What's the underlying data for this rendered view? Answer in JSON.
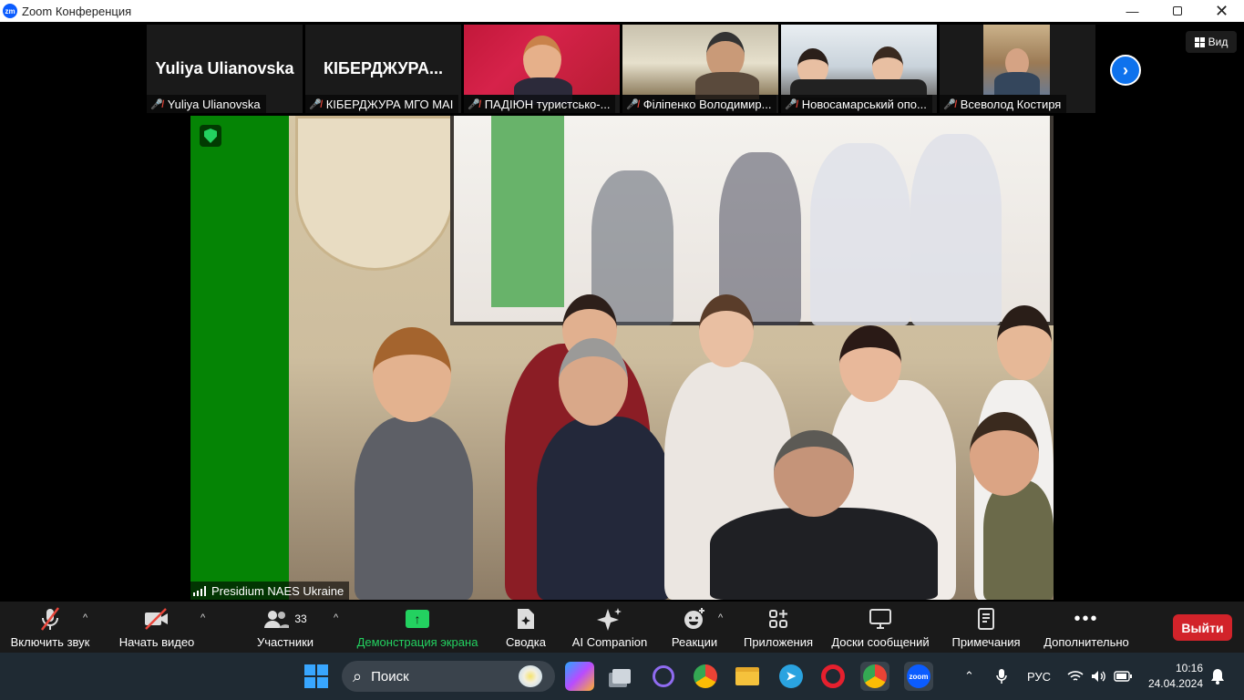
{
  "window": {
    "app_logo": "zm",
    "title": "Zoom Конференция",
    "controls": [
      "minimize-icon",
      "restore-icon",
      "close-icon"
    ]
  },
  "view_button": {
    "label": "Вид",
    "icon": "grid-icon"
  },
  "thumbnails": [
    {
      "big_name": "Yuliya Ulianovska",
      "name": "Yuliya Ulianovska",
      "muted": true,
      "video": false
    },
    {
      "big_name": "КІБЕРДЖУРА...",
      "name": "КІБЕРДЖУРА МГО МАІ",
      "muted": true,
      "video": false
    },
    {
      "name": "ПАДІЮН туристсько-...",
      "muted": true,
      "video": true
    },
    {
      "name": "Філіпенко Володимир...",
      "muted": true,
      "video": true
    },
    {
      "name": "Новосамарський опо...",
      "muted": true,
      "video": true
    },
    {
      "name": "Всеволод Костиря",
      "muted": true,
      "video": true
    }
  ],
  "main_video": {
    "speaker_name": "Presidium NAES Ukraine",
    "encryption_icon": "shield-check-icon",
    "signal_icon": "signal-bars-icon"
  },
  "toolbar": {
    "mute_label": "Включить звук",
    "video_label": "Начать видео",
    "participants_label": "Участники",
    "participants_count": "33",
    "share_label": "Демонстрация экрана",
    "summary_label": "Сводка",
    "ai_label": "AI Companion",
    "reactions_label": "Реакции",
    "apps_label": "Приложения",
    "whiteboards_label": "Доски сообщений",
    "notes_label": "Примечания",
    "more_label": "Дополнительно",
    "leave_label": "Выйти"
  },
  "taskbar": {
    "search_placeholder": "Поиск",
    "language": "РУС",
    "time": "10:16",
    "date": "24.04.2024",
    "apps": [
      "copilot-icon",
      "task-view-icon",
      "viber-icon",
      "chrome-icon",
      "file-explorer-icon",
      "telegram-icon",
      "opera-icon",
      "chrome-profile-icon",
      "zoom-icon"
    ],
    "zoom_app_label": "zoom"
  },
  "colors": {
    "accent": "#0e72ed",
    "share_green": "#23d160",
    "leave_red": "#d2232a",
    "muted_red": "#e8463b"
  }
}
